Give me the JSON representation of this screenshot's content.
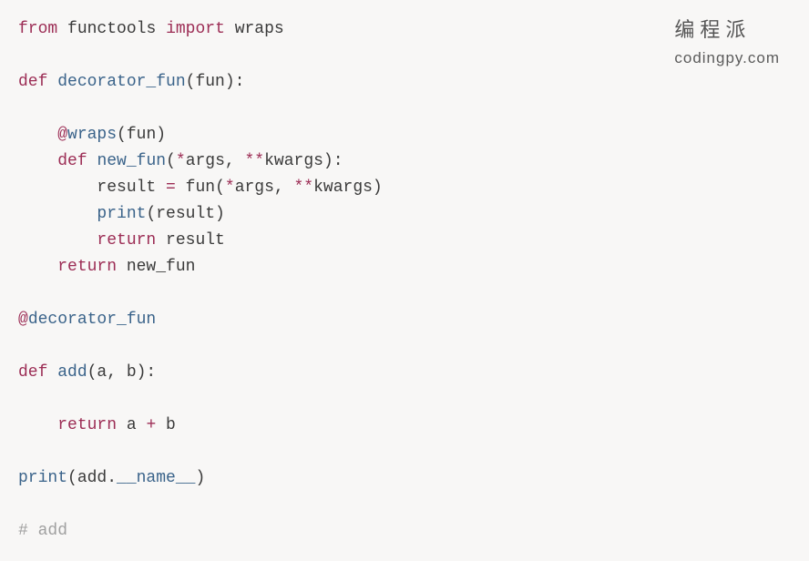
{
  "watermark": {
    "cn": "编程派",
    "en": "codingpy.com"
  },
  "code": {
    "l1": {
      "from": "from",
      "mod": "functools",
      "import": "import",
      "name": "wraps"
    },
    "l3": {
      "def": "def",
      "name": "decorator_fun",
      "args": "(fun):"
    },
    "l5": {
      "at": "@",
      "name": "wraps",
      "args": "(fun)"
    },
    "l6": {
      "def": "def",
      "name": "new_fun",
      "open": "(",
      "star1": "*",
      "a1": "args, ",
      "star2": "**",
      "a2": "kwargs):"
    },
    "l7": {
      "lhs": "result ",
      "eq": "=",
      "sp": " fun(",
      "star1": "*",
      "a1": "args, ",
      "star2": "**",
      "a2": "kwargs)"
    },
    "l8": {
      "fn": "print",
      "args": "(result)"
    },
    "l9": {
      "ret": "return",
      "val": " result"
    },
    "l10": {
      "ret": "return",
      "val": " new_fun"
    },
    "l12": {
      "at": "@",
      "name": "decorator_fun"
    },
    "l14": {
      "def": "def",
      "name": "add",
      "args": "(a, b):"
    },
    "l16": {
      "ret": "return",
      "val": " a ",
      "op": "+",
      "val2": " b"
    },
    "l18": {
      "fn": "print",
      "open": "(add.",
      "dunder": "__name__",
      "close": ")"
    },
    "l20": {
      "comment": "# add"
    }
  }
}
